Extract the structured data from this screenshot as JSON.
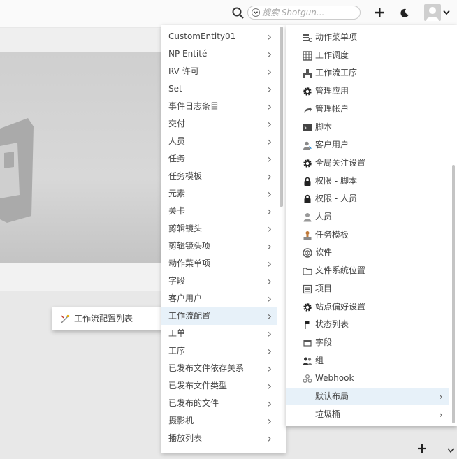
{
  "topbar": {
    "search_placeholder": "搜索 Shotgun..."
  },
  "left_submenu": {
    "items": [
      {
        "label": "工作流配置列表"
      }
    ]
  },
  "entity_menu": {
    "items": [
      {
        "label": "CustomEntity01"
      },
      {
        "label": "NP Entité"
      },
      {
        "label": "RV 许可"
      },
      {
        "label": "Set"
      },
      {
        "label": "事件日志条目"
      },
      {
        "label": "交付"
      },
      {
        "label": "人员"
      },
      {
        "label": "任务"
      },
      {
        "label": "任务模板"
      },
      {
        "label": "元素"
      },
      {
        "label": "关卡"
      },
      {
        "label": "剪辑镜头"
      },
      {
        "label": "剪辑镜头项"
      },
      {
        "label": "动作菜单项"
      },
      {
        "label": "字段"
      },
      {
        "label": "客户用户"
      },
      {
        "label": "工作流配置"
      },
      {
        "label": "工单"
      },
      {
        "label": "工序"
      },
      {
        "label": "已发布文件依存关系"
      },
      {
        "label": "已发布文件类型"
      },
      {
        "label": "已发布的文件"
      },
      {
        "label": "摄影机"
      },
      {
        "label": "播放列表"
      }
    ],
    "highlighted": "工作流配置"
  },
  "admin_menu": {
    "items": [
      {
        "label": "动作菜单项",
        "icon": "action-menu-icon"
      },
      {
        "label": "工作调度",
        "icon": "calendar-grid-icon"
      },
      {
        "label": "工作流工序",
        "icon": "pipeline-step-icon"
      },
      {
        "label": "管理应用",
        "icon": "gear-icon"
      },
      {
        "label": "管理帐户",
        "icon": "share-arrow-icon"
      },
      {
        "label": "脚本",
        "icon": "terminal-icon"
      },
      {
        "label": "客户用户",
        "icon": "client-user-icon"
      },
      {
        "label": "全局关注设置",
        "icon": "gear-icon"
      },
      {
        "label": "权限 - 脚本",
        "icon": "lock-icon"
      },
      {
        "label": "权限 - 人员",
        "icon": "lock-icon"
      },
      {
        "label": "人员",
        "icon": "person-icon"
      },
      {
        "label": "任务模板",
        "icon": "stamp-icon"
      },
      {
        "label": "软件",
        "icon": "disc-icon"
      },
      {
        "label": "文件系统位置",
        "icon": "folder-icon"
      },
      {
        "label": "项目",
        "icon": "project-icon"
      },
      {
        "label": "站点偏好设置",
        "icon": "gear-icon"
      },
      {
        "label": "状态列表",
        "icon": "flag-icon"
      },
      {
        "label": "字段",
        "icon": "field-icon"
      },
      {
        "label": "组",
        "icon": "group-icon"
      },
      {
        "label": "Webhook",
        "icon": "webhook-icon"
      },
      {
        "label": "默认布局",
        "icon": ""
      },
      {
        "label": "垃圾桶",
        "icon": ""
      }
    ],
    "highlighted": "默认布局"
  },
  "colors": {
    "highlight": "#e7f1f9",
    "menu_bg": "#ffffff",
    "text": "#444444"
  }
}
